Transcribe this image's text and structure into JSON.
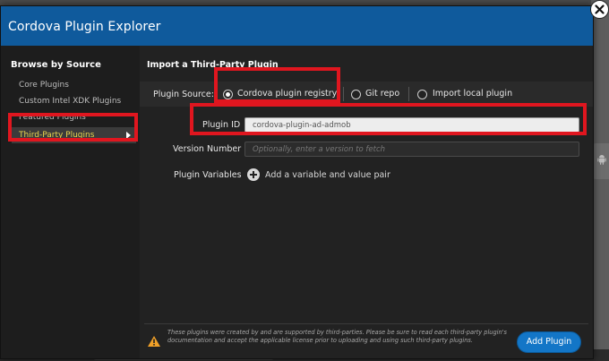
{
  "dialog": {
    "title": "Cordova Plugin Explorer"
  },
  "sidebar": {
    "heading": "Browse by Source",
    "items": [
      {
        "label": "Core Plugins"
      },
      {
        "label": "Custom Intel XDK Plugins"
      },
      {
        "label": "Featured Plugins"
      },
      {
        "label": "Third-Party Plugins",
        "selected": true
      }
    ]
  },
  "main": {
    "section_title": "Import a Third-Party Plugin",
    "plugin_source": {
      "label": "Plugin Source:",
      "options": [
        {
          "label": "Cordova plugin registry",
          "checked": true
        },
        {
          "label": "Git repo",
          "checked": false
        },
        {
          "label": "Import local plugin",
          "checked": false
        }
      ]
    },
    "plugin_id": {
      "label": "Plugin ID",
      "value": "cordova-plugin-ad-admob"
    },
    "version_number": {
      "label": "Version Number",
      "placeholder": "Optionally, enter a version to fetch"
    },
    "plugin_variables": {
      "label": "Plugin Variables",
      "add_text": "Add a variable and value pair"
    },
    "footer": {
      "notice": "These plugins were created by and are supported by third-parties. Please be sure to read each third-party plugin's documentation and accept the applicable license prior to uploading and using such third-party plugins.",
      "add_button": "Add Plugin"
    }
  },
  "colors": {
    "title_bar": "#0f5a9c",
    "selected_item_text": "#e8d44d",
    "highlight": "#e0161f",
    "add_button": "#1376c7",
    "warning": "#f0a028"
  }
}
